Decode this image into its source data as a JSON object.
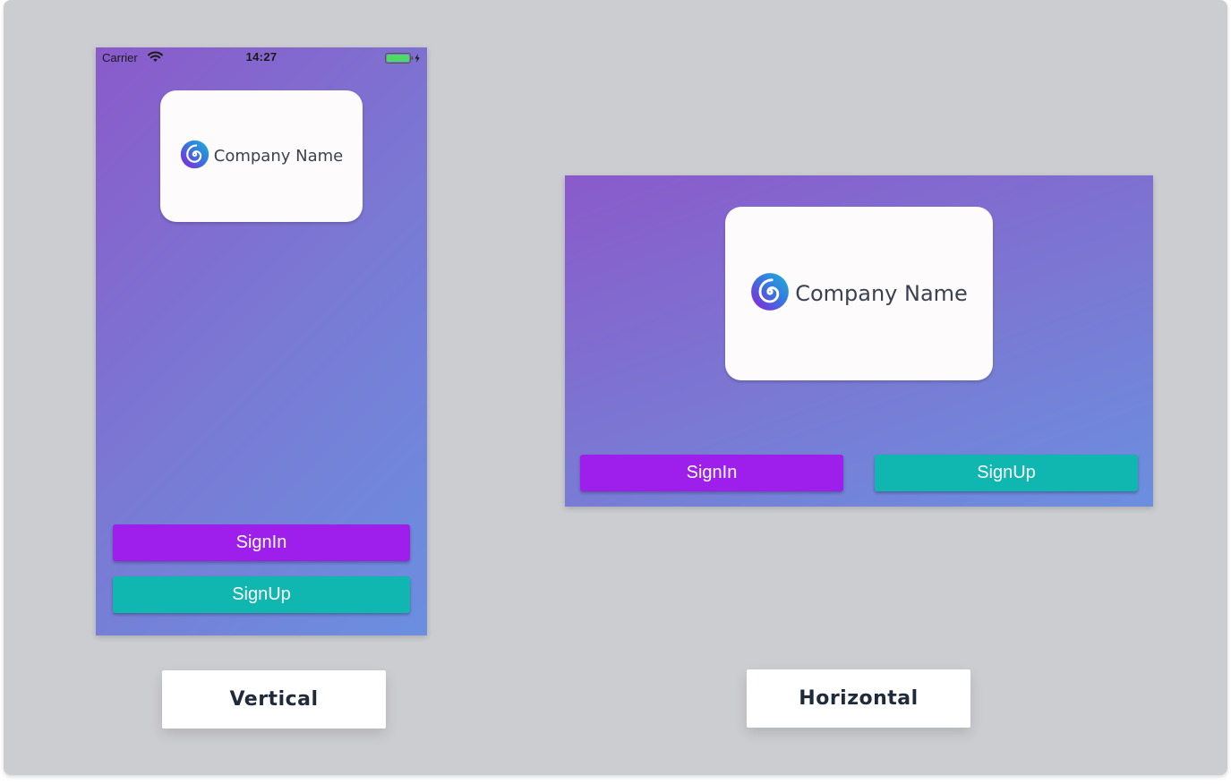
{
  "vertical_preview": {
    "status_bar": {
      "carrier": "Carrier",
      "time": "14:27",
      "wifi_icon": "wifi-icon",
      "battery_icon": "battery-charging-icon",
      "battery_color": "#4cd964"
    },
    "logo": {
      "icon": "spiral-logo-icon",
      "company_name": "Company Name"
    },
    "buttons": {
      "signin_label": "SignIn",
      "signup_label": "SignUp"
    },
    "caption": "Vertical"
  },
  "horizontal_preview": {
    "logo": {
      "icon": "spiral-logo-icon",
      "company_name": "Company Name"
    },
    "buttons": {
      "signin_label": "SignIn",
      "signup_label": "SignUp"
    },
    "caption": "Horizontal"
  },
  "colors": {
    "background": "#cccdd1",
    "gradient_start": "#8a5acb",
    "gradient_end": "#6b8fe0",
    "signin": "#9e1feb",
    "signup": "#10b7b1",
    "card": "#fdfbfb",
    "company_text": "#3a4252"
  }
}
